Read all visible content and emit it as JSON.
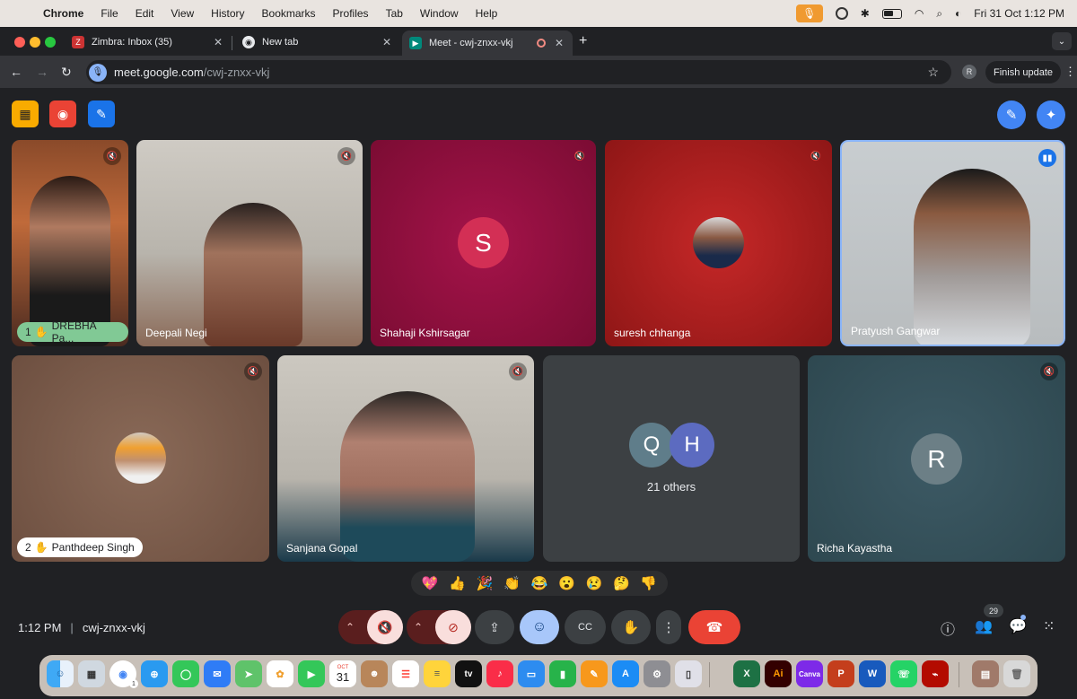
{
  "menubar": {
    "app": "Chrome",
    "items": [
      "File",
      "Edit",
      "View",
      "History",
      "Bookmarks",
      "Profiles",
      "Tab",
      "Window",
      "Help"
    ],
    "datetime": "Fri 31 Oct  1:12 PM"
  },
  "tabs": [
    {
      "label": "Zimbra: Inbox (35)"
    },
    {
      "label": "New tab"
    },
    {
      "label": "Meet - cwj-znxx-vkj"
    }
  ],
  "address": {
    "host": "meet.google.com",
    "path": "/cwj-znxx-vkj"
  },
  "toolbar": {
    "profile_initial": "R",
    "finish_update": "Finish update"
  },
  "participants": [
    {
      "name": "DREBHA Pa...",
      "hand": "1"
    },
    {
      "name": "Deepali Negi"
    },
    {
      "name": "Shahaji Kshirsagar",
      "initial": "S"
    },
    {
      "name": "suresh chhanga"
    },
    {
      "name": "Pratyush Gangwar"
    },
    {
      "name": "Panthdeep Singh",
      "hand": "2"
    },
    {
      "name": "Sanjana Gopal"
    },
    {
      "name": "Richa Kayastha",
      "initial": "R"
    }
  ],
  "others": {
    "initials": [
      "Q",
      "H"
    ],
    "label": "21 others"
  },
  "reactions": [
    "💖",
    "👍",
    "🎉",
    "👏",
    "😂",
    "😮",
    "😢",
    "🤔",
    "👎"
  ],
  "meeting": {
    "time": "1:12 PM",
    "separator": "|",
    "code": "cwj-znxx-vkj"
  },
  "people_count": "29",
  "dock_labels": {
    "calendar_month": "OCT",
    "calendar_day": "31",
    "tv": "tv",
    "chrome_badge": "1"
  }
}
